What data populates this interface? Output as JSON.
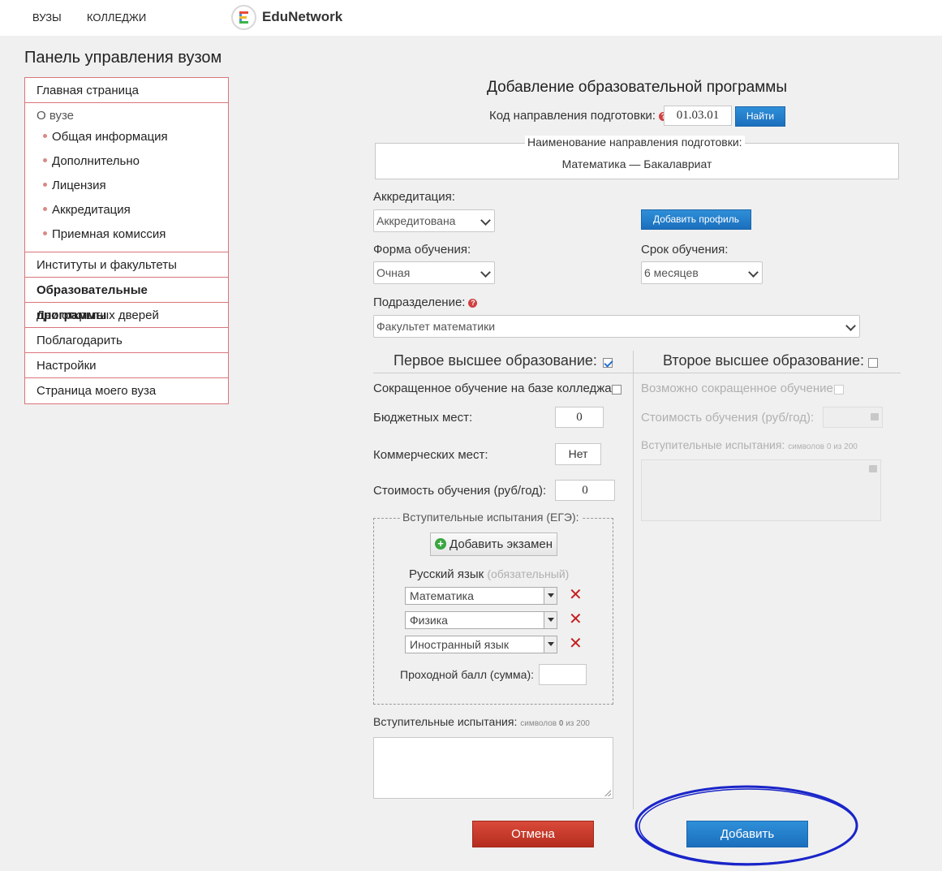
{
  "header": {
    "nav": [
      "ВУЗЫ",
      "КОЛЛЕДЖИ"
    ],
    "logo_letter": "E",
    "logo_text": "EduNetwork"
  },
  "sidebar": {
    "title": "Панель управления вузом",
    "items": [
      {
        "label": "Главная страница"
      },
      {
        "label": "О вузе",
        "children": [
          "Общая информация",
          "Дополнительно",
          "Лицензия",
          "Аккредитация",
          "Приемная комиссия"
        ]
      },
      {
        "label": "Институты и факультеты"
      },
      {
        "label": "Образовательные программы",
        "active": true
      },
      {
        "label": "Дни открытых дверей"
      },
      {
        "label": "Поблагодарить"
      },
      {
        "label": "Настройки"
      },
      {
        "label": "Страница моего вуза"
      }
    ]
  },
  "form": {
    "title": "Добавление образовательной программы",
    "code_label": "Код направления подготовки:",
    "code_value": "01.03.01",
    "find_button": "Найти",
    "direction_legend": "Наименование направления подготовки:",
    "direction_value": "Математика — Бакалавриат",
    "accreditation_label": "Аккредитация:",
    "accreditation_value": "Аккредитована",
    "add_profile_button": "Добавить профиль",
    "study_form_label": "Форма обучения:",
    "study_form_value": "Очная",
    "duration_label": "Срок обучения:",
    "duration_value": "6 месяцев",
    "department_label": "Подразделение:",
    "department_value": "Факультет математики"
  },
  "first_higher": {
    "heading": "Первое высшее образование:",
    "checked": true,
    "short_label": "Сокращенное обучение на базе колледжа:",
    "budget_label": "Бюджетных мест:",
    "budget_value": "0",
    "commercial_label": "Коммерческих мест:",
    "commercial_value": "Нет",
    "cost_label": "Стоимость обучения (руб/год):",
    "cost_value": "0",
    "exams_legend": "Вступительные испытания (ЕГЭ):",
    "add_exam_button": "Добавить экзамен",
    "mandatory_exam": "Русский язык",
    "mandatory_note": "(обязательный)",
    "exams": [
      "Математика",
      "Физика",
      "Иностранный язык"
    ],
    "pass_score_label": "Проходной балл (сумма):",
    "pass_score_value": "",
    "tests_label": "Вступительные испытания:",
    "tests_counter_prefix": "символов",
    "tests_counter_value": "0",
    "tests_counter_suffix": "из 200"
  },
  "second_higher": {
    "heading": "Второе высшее образование:",
    "checked": false,
    "short_label": "Возможно сокращенное обучение:",
    "cost_label": "Стоимость обучения (руб/год):",
    "tests_label": "Вступительные испытания:",
    "tests_counter": "символов 0 из 200"
  },
  "actions": {
    "cancel": "Отмена",
    "submit": "Добавить"
  },
  "colors": {
    "primary_blue": "#1b6fbd",
    "cancel_red": "#c0392b",
    "sidebar_border": "#d9757a",
    "highlight_ellipse": "#1a25c9"
  }
}
